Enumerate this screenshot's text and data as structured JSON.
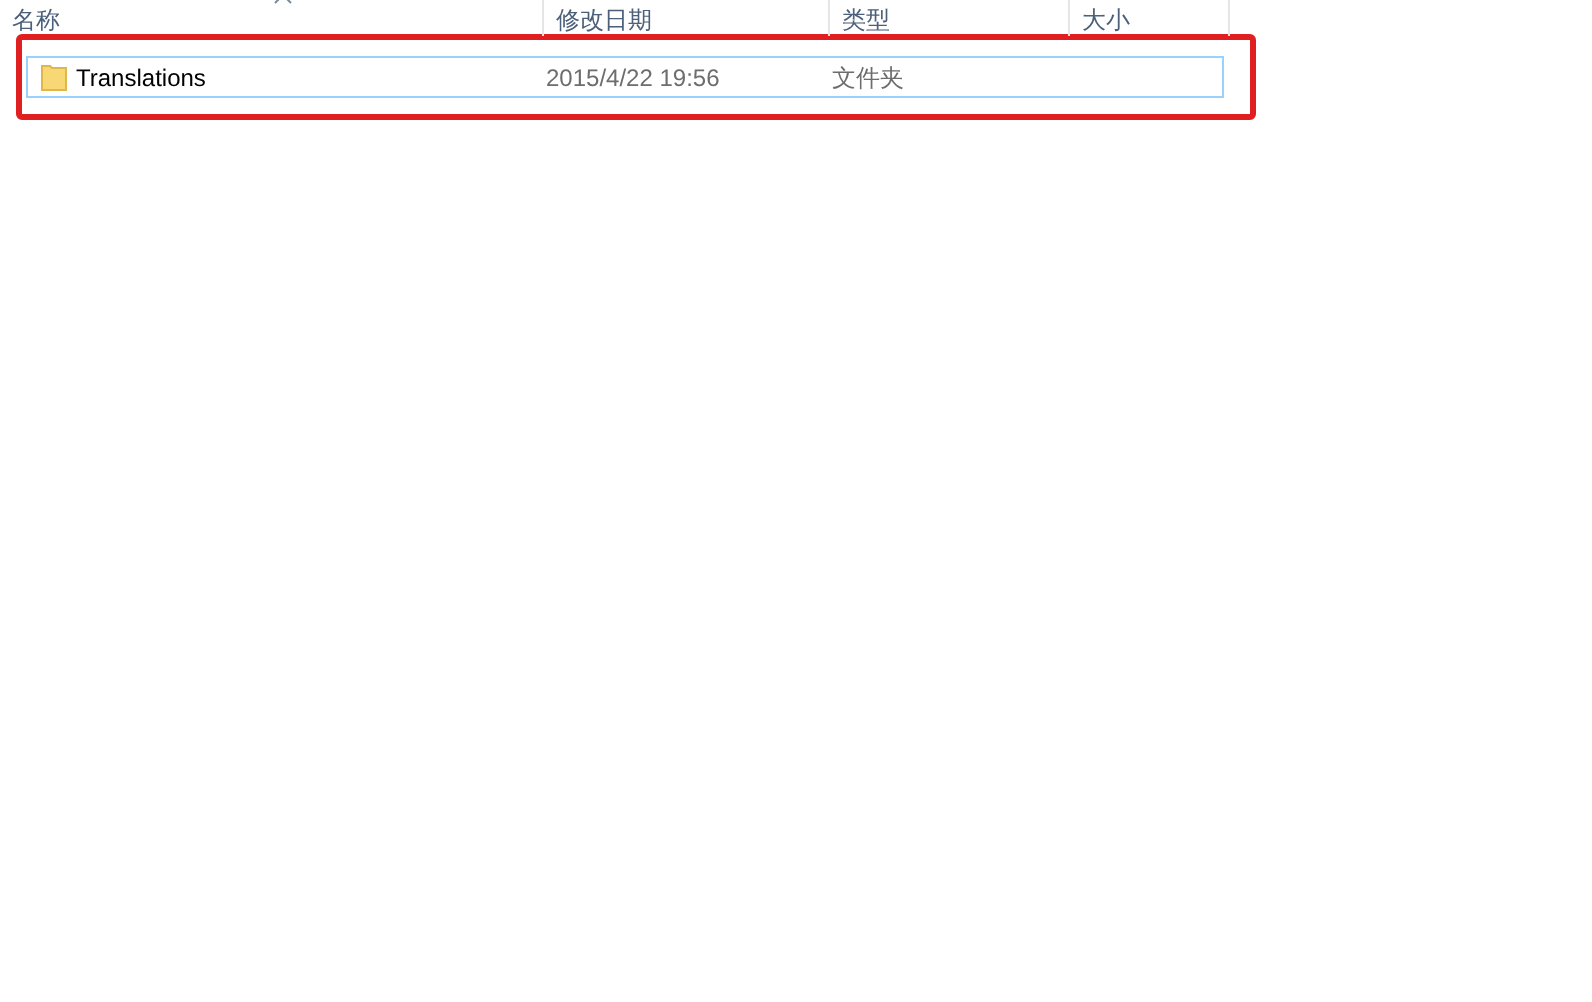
{
  "file_list": {
    "columns": [
      {
        "label": "名称",
        "sorted": true
      },
      {
        "label": "修改日期",
        "sorted": false
      },
      {
        "label": "类型",
        "sorted": false
      },
      {
        "label": "大小",
        "sorted": false
      }
    ],
    "rows": [
      {
        "name": "Translations",
        "modified": "2015/4/22 19:56",
        "type": "文件夹",
        "selected": true,
        "annotated": true
      }
    ]
  }
}
